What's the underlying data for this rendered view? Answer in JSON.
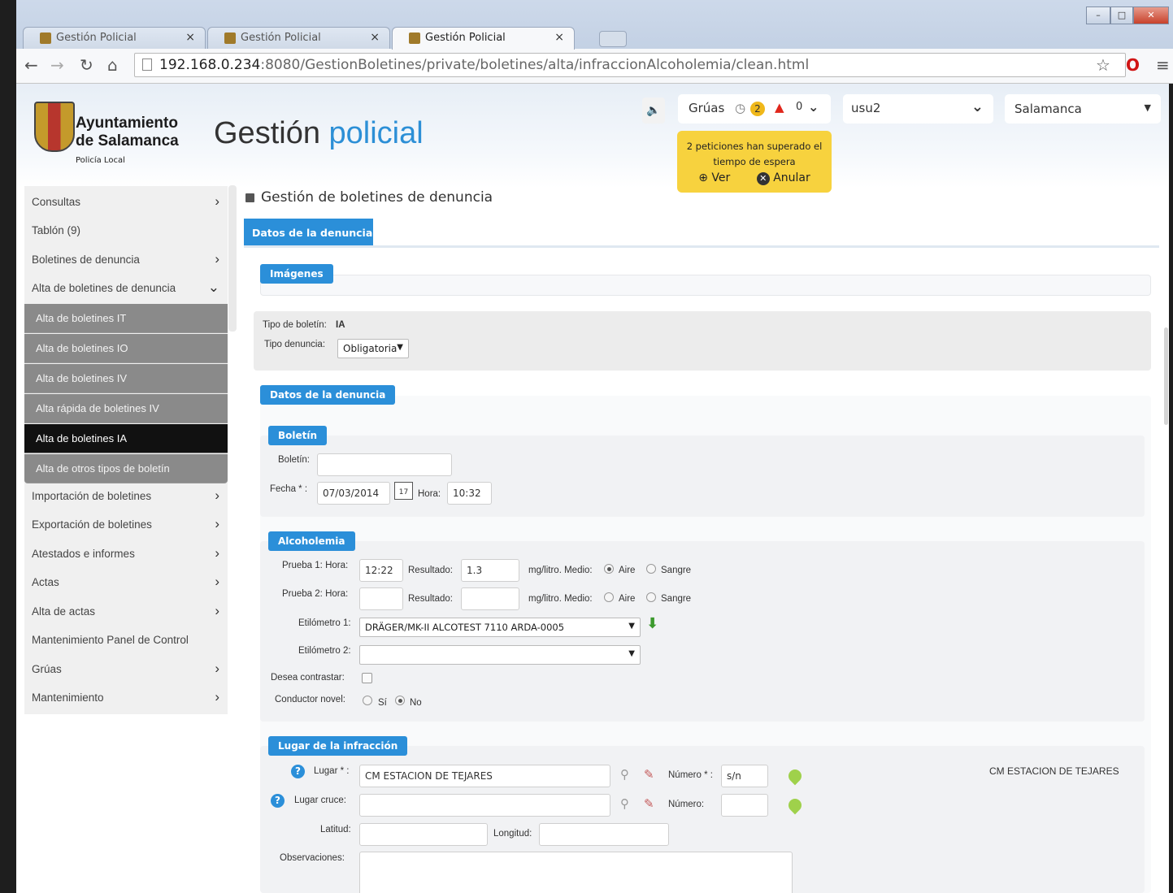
{
  "browser": {
    "tabs": [
      {
        "title": "Gestión Policial",
        "active": false
      },
      {
        "title": "Gestión Policial",
        "active": false
      },
      {
        "title": "Gestión Policial",
        "active": true
      }
    ],
    "url_host": "192.168.0.234",
    "url_path": ":8080/GestionBoletines/private/boletines/alta/infraccionAlcoholemia/clean.html",
    "window_buttons": {
      "minimize": "–",
      "maximize": "□",
      "close": "✕"
    }
  },
  "header": {
    "logo_line1": "Ayuntamiento",
    "logo_line2": "de Salamanca",
    "logo_line3": "Policía Local",
    "app_title_1": "Gestión",
    "app_title_2": "policial",
    "gruas_label": "Grúas",
    "clock_badge": "2",
    "alert_count": "0",
    "user": "usu2",
    "city": "Salamanca",
    "alert_text_1": "2 peticiones han superado el",
    "alert_text_2": "tiempo de espera",
    "alert_ver": "Ver",
    "alert_anular": "Anular"
  },
  "sidebar": {
    "items": [
      {
        "label": "Consultas",
        "chevron": "›"
      },
      {
        "label": "Tablón (9)",
        "chevron": ""
      },
      {
        "label": "Boletines de denuncia",
        "chevron": "›"
      },
      {
        "label": "Alta de boletines de denuncia",
        "chevron": "⌄"
      }
    ],
    "subitems": [
      {
        "label": "Alta de boletines IT",
        "active": false
      },
      {
        "label": "Alta de boletines IO",
        "active": false
      },
      {
        "label": "Alta de boletines IV",
        "active": false
      },
      {
        "label": "Alta rápida de boletines IV",
        "active": false
      },
      {
        "label": "Alta de boletines IA",
        "active": true
      },
      {
        "label": "Alta de otros tipos de boletín",
        "active": false
      }
    ],
    "items_after": [
      {
        "label": "Importación de boletines",
        "chevron": "›"
      },
      {
        "label": "Exportación de boletines",
        "chevron": "›"
      },
      {
        "label": "Atestados e informes",
        "chevron": "›"
      },
      {
        "label": "Actas",
        "chevron": "›"
      },
      {
        "label": "Alta de actas",
        "chevron": "›"
      },
      {
        "label": "Mantenimiento Panel de Control",
        "chevron": ""
      },
      {
        "label": "Grúas",
        "chevron": "›"
      },
      {
        "label": "Mantenimiento",
        "chevron": "›"
      }
    ]
  },
  "main": {
    "breadcrumb": "Gestión de boletines de denuncia",
    "tab": "Datos de la denuncia",
    "imagenes_legend": "Imágenes",
    "tipo_boletin_label": "Tipo de boletín:",
    "tipo_boletin_value": "IA",
    "tipo_denuncia_label": "Tipo denuncia:",
    "tipo_denuncia_value": "Obligatoria",
    "datos_legend": "Datos de la denuncia",
    "boletin_legend": "Boletín",
    "boletin_label": "Boletín:",
    "boletin_value": "",
    "fecha_label": "Fecha * :",
    "fecha_value": "07/03/2014",
    "calendar_day": "17",
    "hora_label": "Hora:",
    "hora_value": "10:32",
    "alcoholemia_legend": "Alcoholemia",
    "prueba1_label": "Prueba 1: Hora:",
    "prueba1_hora": "12:22",
    "resultado_label": "Resultado:",
    "prueba1_resultado": "1.3",
    "mgl_label": "mg/litro. Medio:",
    "aire_label": "Aire",
    "sangre_label": "Sangre",
    "prueba2_label": "Prueba 2: Hora:",
    "prueba2_hora": "",
    "prueba2_resultado": "",
    "etilometro1_label": "Etilómetro 1:",
    "etilometro1_value": "DRÄGER/MK-II ALCOTEST 7110 ARDA-0005",
    "etilometro2_label": "Etilómetro 2:",
    "etilometro2_value": "",
    "contrastar_label": "Desea contrastar:",
    "novel_label": "Conductor novel:",
    "si_label": "Sí",
    "no_label": "No",
    "lugar_legend": "Lugar de la infracción",
    "lugar_label": "Lugar * :",
    "lugar_value": "CM ESTACION DE TEJARES",
    "numero_req_label": "Número * :",
    "numero_value": "s/n",
    "lugar_display": "CM ESTACION DE TEJARES",
    "lugar_cruce_label": "Lugar cruce:",
    "lugar_cruce_value": "",
    "numero_label": "Número:",
    "latitud_label": "Latitud:",
    "longitud_label": "Longitud:",
    "observaciones_label": "Observaciones:",
    "help_glyph": "?"
  }
}
